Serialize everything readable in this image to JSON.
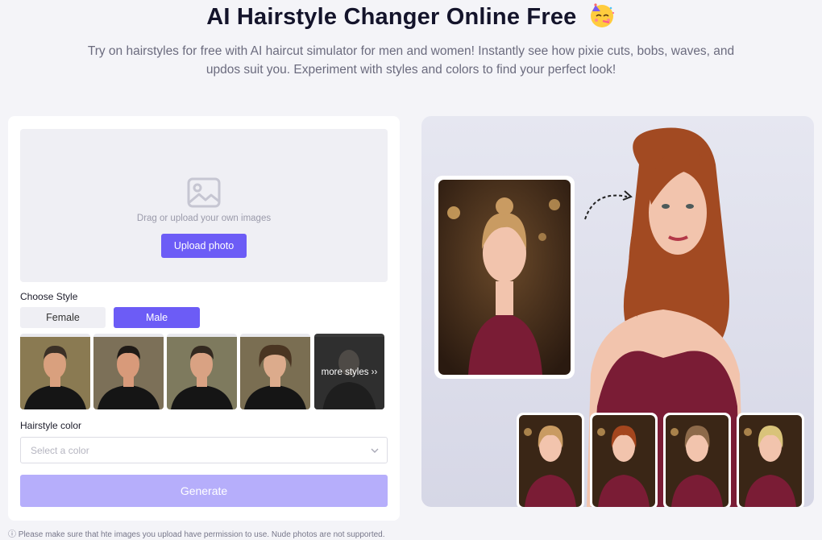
{
  "header": {
    "title": "AI Hairstyle Changer Online Free",
    "subtitle": "Try on hairstyles for free with AI haircut simulator for men and women! Instantly see how pixie cuts, bobs, waves, and updos suit you. Experiment with styles and colors to find your perfect look!"
  },
  "upload": {
    "icon": "image-icon",
    "hint": "Drag or upload your own images",
    "button_label": "Upload photo"
  },
  "style": {
    "label": "Choose Style",
    "tabs": [
      {
        "label": "Female",
        "selected": false
      },
      {
        "label": "Male",
        "selected": true
      }
    ],
    "thumbnails": [
      {
        "hair": "#3b3026",
        "skin": "#d9a07e",
        "bg": "#8a7a52"
      },
      {
        "hair": "#1f1a16",
        "skin": "#d89a7a",
        "bg": "#7c7058"
      },
      {
        "hair": "#332920",
        "skin": "#d9a283",
        "bg": "#7e7a5e"
      },
      {
        "hair": "#4a3522",
        "skin": "#dcab8c",
        "bg": "#7a6e52"
      }
    ],
    "more_label": "more styles ››"
  },
  "color": {
    "label": "Hairstyle color",
    "placeholder": "Select a color"
  },
  "generate_label": "Generate",
  "note": "Please make sure that hte images you upload have permission to use. Nude photos are not supported.",
  "showcase": {
    "main_hair": "#a24a22",
    "dress": "#7a1c35",
    "skin": "#f2c4ad",
    "variants": [
      {
        "hair": "#c99b62"
      },
      {
        "hair": "#a4461e"
      },
      {
        "hair": "#8d6a4a"
      },
      {
        "hair": "#d9c37a"
      }
    ]
  }
}
